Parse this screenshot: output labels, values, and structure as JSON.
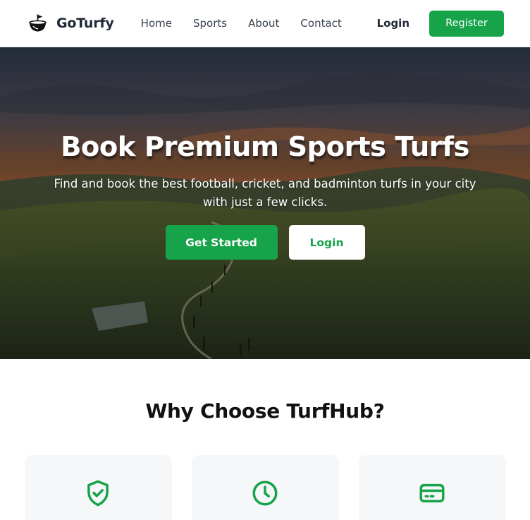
{
  "brand": {
    "name": "GoTurfy",
    "logo_icon": "golf-bowl-icon"
  },
  "nav": {
    "links": [
      {
        "label": "Home"
      },
      {
        "label": "Sports"
      },
      {
        "label": "About"
      },
      {
        "label": "Contact"
      }
    ],
    "login_label": "Login",
    "register_label": "Register"
  },
  "hero": {
    "title": "Book Premium Sports Turfs",
    "subtitle": "Find and book the best football, cricket, and badminton turfs in your city with just a few clicks.",
    "primary_button": "Get Started",
    "secondary_button": "Login",
    "background": "rolling green hills at sunset"
  },
  "features": {
    "title": "Why Choose TurfHub?",
    "cards": [
      {
        "icon": "shield-check-icon"
      },
      {
        "icon": "clock-icon"
      },
      {
        "icon": "credit-card-icon"
      }
    ]
  },
  "colors": {
    "accent": "#16a34a",
    "text_dark": "#1f2937",
    "card_bg": "#f6f7f9"
  }
}
